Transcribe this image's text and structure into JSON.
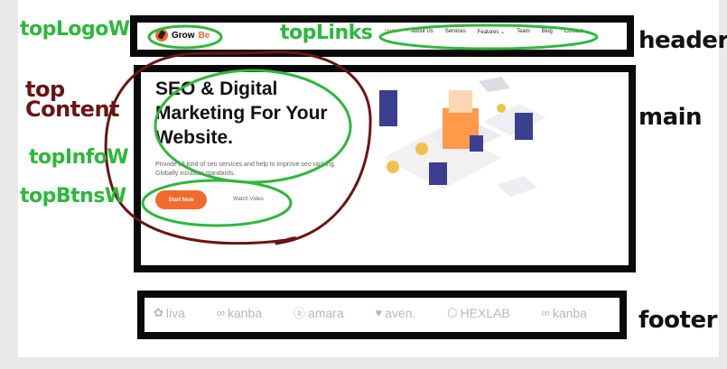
{
  "header": {
    "logo_prefix": "Grow",
    "logo_suffix": "Be",
    "nav": [
      "Home",
      "About Us",
      "Services",
      "Features ⌄",
      "Team",
      "Blog",
      "Contact"
    ]
  },
  "hero": {
    "title": "SEO & Digital Marketing For Your Website.",
    "description": "Provide all kind of seo services and help to improve seo ranking. Globally incubate standards.",
    "primary_button": "Start Now",
    "secondary_button": "Watch Video"
  },
  "footer": {
    "brands": [
      {
        "name": "liva",
        "icon": "cluster-icon"
      },
      {
        "name": "kanba",
        "icon": "infinity-icon"
      },
      {
        "name": "amara",
        "icon": "circle-a-icon"
      },
      {
        "name": "aven.",
        "icon": "heart-icon"
      },
      {
        "name": "HEXLAB",
        "icon": "hexagon-icon"
      },
      {
        "name": "kanba",
        "icon": "infinity-icon"
      }
    ]
  },
  "annotations": {
    "top_logo": "topLogoW",
    "top_links": "topLinks",
    "header": "header",
    "top_content": "top Content",
    "main": "main",
    "top_info": "topInfoW",
    "top_btns": "topBtnsW",
    "footer": "footer"
  },
  "colors": {
    "accent": "#f36a2d",
    "annotation_green": "#2db83a",
    "annotation_maroon": "#6b1414"
  }
}
